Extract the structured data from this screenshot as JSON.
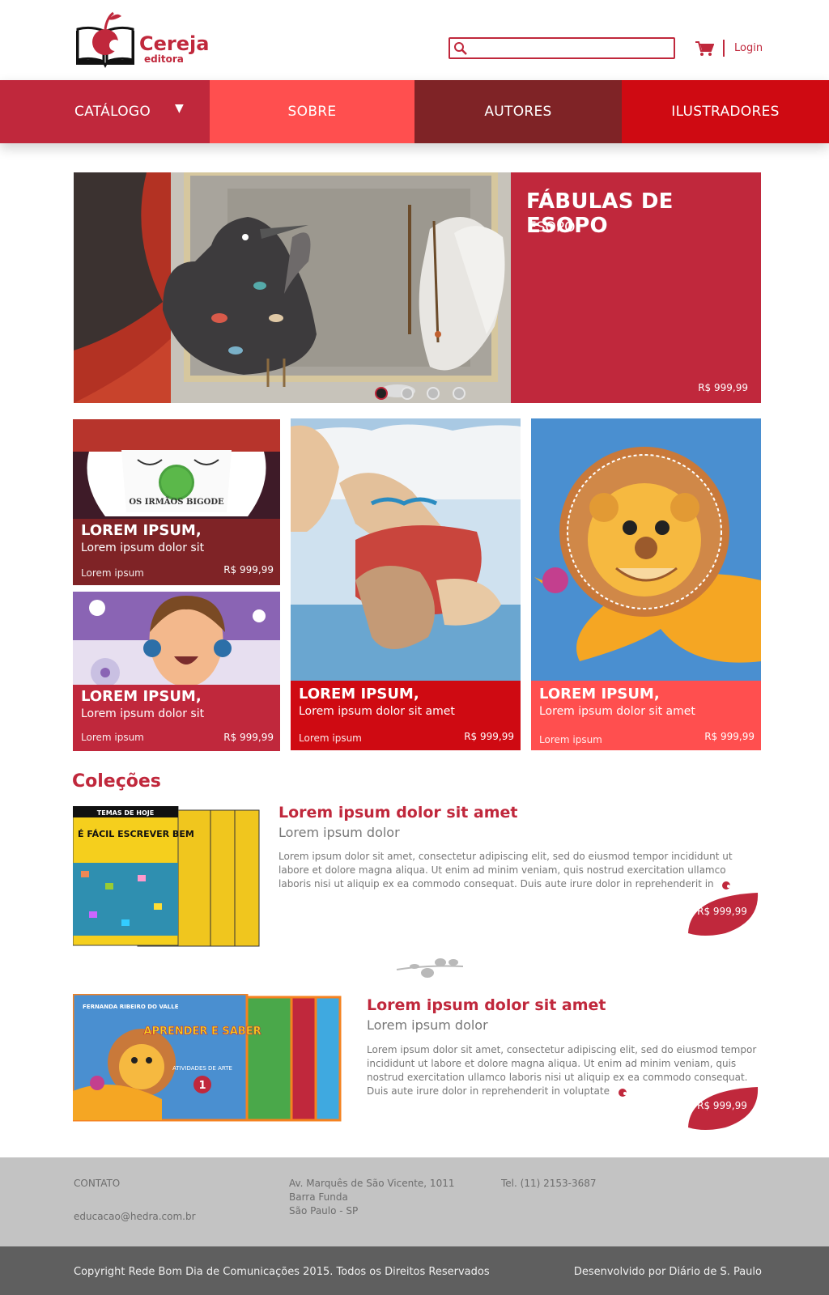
{
  "brand": {
    "name": "Cereja",
    "sub": "editora"
  },
  "header": {
    "search_placeholder": "",
    "login": "Login"
  },
  "nav": {
    "catalogo": "CATÁLOGO",
    "sobre": "SOBRE",
    "autores": "AUTORES",
    "ilustradores": "ILUSTRADORES"
  },
  "hero": {
    "title": "FÁBULAS DE ESOPO",
    "author": "ESOPO",
    "price": "R$ 999,99"
  },
  "cards": [
    {
      "title": "LOREM IPSUM,",
      "subtitle": "Lorem ipsum dolor sit",
      "meta": "Lorem ipsum",
      "price": "R$ 999,99",
      "cover_text": "OS IRMÃOS BIGODE"
    },
    {
      "title": "LOREM IPSUM,",
      "subtitle": "Lorem ipsum dolor sit",
      "meta": "Lorem ipsum",
      "price": "R$ 999,99"
    },
    {
      "title": "LOREM IPSUM,",
      "subtitle": "Lorem ipsum dolor sit amet",
      "meta": "Lorem ipsum",
      "price": "R$ 999,99"
    },
    {
      "title": "LOREM IPSUM,",
      "subtitle": "Lorem ipsum dolor sit amet",
      "meta": "Lorem ipsum",
      "price": "R$ 999,99"
    }
  ],
  "collections": {
    "heading": "Coleções",
    "items": [
      {
        "title": "Lorem ipsum dolor sit amet",
        "subtitle": "Lorem ipsum dolor",
        "desc": "Lorem ipsum dolor sit amet, consectetur adipiscing elit, sed do eiusmod tempor incididunt ut labore et dolore magna aliqua. Ut enim ad minim veniam, quis nostrud exercitation ullamco laboris nisi ut aliquip ex ea commodo consequat. Duis aute irure dolor in reprehenderit in",
        "price": "R$ 999,99",
        "cover": {
          "series": "TEMAS DE HOJE",
          "title": "É FÁCIL ESCREVER BEM"
        }
      },
      {
        "title": "Lorem ipsum dolor sit amet",
        "subtitle": "Lorem ipsum dolor",
        "desc": "Lorem ipsum dolor sit amet, consectetur adipiscing elit, sed do eiusmod tempor incididunt ut labore et dolore magna aliqua. Ut enim ad minim veniam, quis nostrud exercitation ullamco laboris nisi ut aliquip ex ea commodo consequat. Duis aute irure dolor in reprehenderit in voluptate",
        "price": "R$ 999,99",
        "cover": {
          "author": "FERNANDA RIBEIRO DO VALLE",
          "title": "APRENDER E SABER",
          "label": "ATIVIDADES DE ARTE",
          "volume": "1"
        }
      }
    ]
  },
  "footer": {
    "contact_label": "CONTATO",
    "email": "educacao@hedra.com.br",
    "address1": "Av. Marquês de São Vicente, 1011",
    "address2": "Barra Funda",
    "address3": "São Paulo - SP",
    "phone": "Tel. (11) 2153-3687",
    "copyright": "Copyright Rede Bom Dia de Comunicações 2015. Todos os  Direitos Reservados",
    "developer": "Desenvolvido por Diário de S. Paulo"
  },
  "colors": {
    "primary": "#c0283c",
    "coral": "#ff4f4f",
    "maroon": "#7f2326",
    "red": "#cf0a12"
  }
}
